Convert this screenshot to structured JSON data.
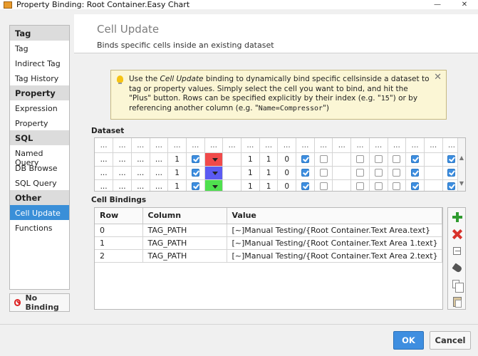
{
  "window": {
    "title": "Property Binding: Root Container.Easy Chart",
    "minimize": "—",
    "close": "✕"
  },
  "sidebar": {
    "groups": [
      {
        "header": "Tag",
        "items": [
          "Tag",
          "Indirect Tag",
          "Tag History"
        ]
      },
      {
        "header": "Property",
        "items": [
          "Expression",
          "Property"
        ]
      },
      {
        "header": "SQL",
        "items": [
          "Named Query",
          "DB Browse",
          "SQL Query"
        ]
      },
      {
        "header": "Other",
        "items": [
          "Cell Update",
          "Functions"
        ]
      }
    ],
    "active": "Cell Update",
    "no_binding_label": "No Binding"
  },
  "header": {
    "title": "Cell Update",
    "description": "Binds specific cells inside an existing dataset"
  },
  "tip": {
    "part1": "Use the ",
    "emph": "Cell Update",
    "part2": " binding to dynamically bind specific cellsinside a dataset to tag or property values. Simply select the cell you want to bind, and hit the \"Plus\" button. Rows can be specified explicitly by their index (e.g. \"",
    "code1": "15",
    "part3": "\") or by referencing another column (e.g. \"",
    "code2": "Name=Compressor",
    "part4": "\")",
    "close": "✕"
  },
  "dataset": {
    "label": "Dataset",
    "header_text": "...",
    "columns": 20,
    "rows": [
      {
        "cells": [
          "...",
          "...",
          "...",
          "...",
          "1",
          "check",
          "color:#f04a4a",
          "",
          "1",
          "1",
          "0",
          "check",
          "box",
          "",
          "box",
          "box",
          "box",
          "check",
          "",
          "check"
        ]
      },
      {
        "cells": [
          "...",
          "...",
          "...",
          "...",
          "1",
          "check",
          "color:#5b5bf2",
          "",
          "1",
          "1",
          "0",
          "check",
          "box",
          "",
          "box",
          "box",
          "box",
          "check",
          "",
          "check"
        ]
      },
      {
        "cells": [
          "...",
          "...",
          "...",
          "...",
          "1",
          "check",
          "color:#4fe04f",
          "",
          "1",
          "1",
          "0",
          "check",
          "box",
          "",
          "box",
          "box",
          "box",
          "check",
          "",
          "check"
        ]
      }
    ]
  },
  "bindings": {
    "label": "Cell Bindings",
    "headers": [
      "Row",
      "Column",
      "Value"
    ],
    "rows": [
      [
        "0",
        "TAG_PATH",
        "[~]Manual Testing/{Root Container.Text Area.text}"
      ],
      [
        "1",
        "TAG_PATH",
        "[~]Manual Testing/{Root Container.Text Area 1.text}"
      ],
      [
        "2",
        "TAG_PATH",
        "[~]Manual Testing/{Root Container.Text Area 2.text}"
      ]
    ]
  },
  "buttons": {
    "ok": "OK",
    "cancel": "Cancel"
  },
  "icons": {
    "add": "plus-icon",
    "remove": "delete-icon",
    "edit": "edit-icon",
    "tag": "tag-icon",
    "copy": "copy-icon",
    "paste": "paste-icon"
  }
}
